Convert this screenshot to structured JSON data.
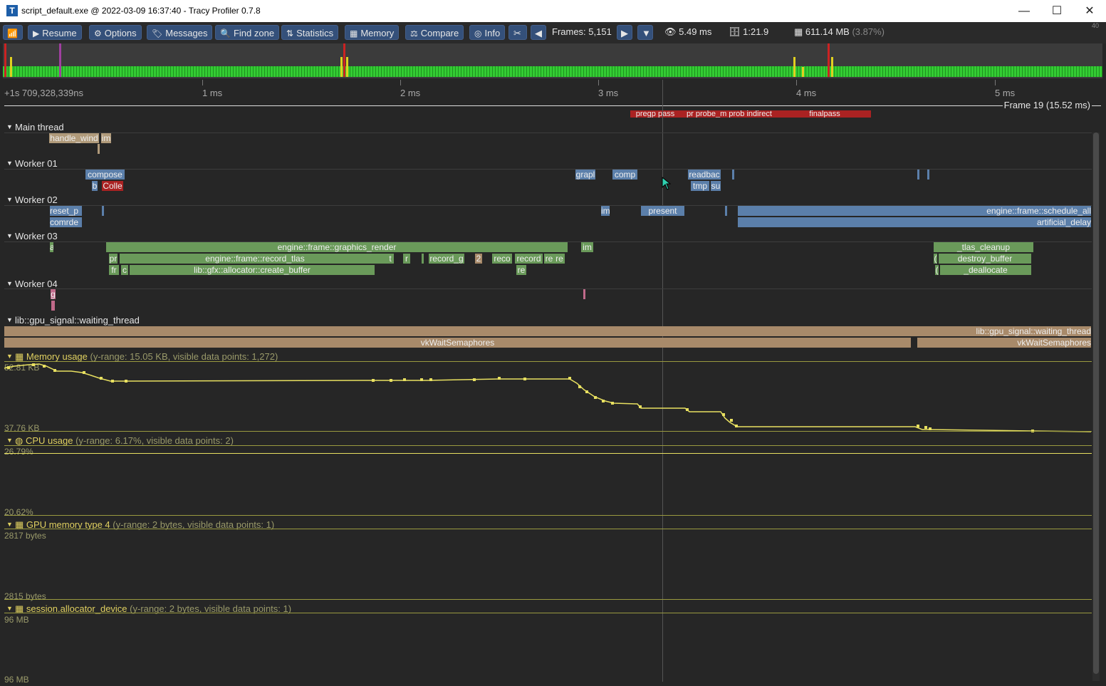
{
  "window": {
    "icon_letter": "T",
    "title": "script_default.exe @ 2022-03-09 16:37:40 - Tracy Profiler 0.7.8",
    "minimize": "—",
    "maximize": "☐",
    "close": "✕"
  },
  "toolbar": {
    "connection_icon": "wifi-icon",
    "resume": "Resume",
    "options": "Options",
    "messages": "Messages",
    "find_zone": "Find zone",
    "statistics": "Statistics",
    "memory": "Memory",
    "compare": "Compare",
    "info": "Info",
    "frames": "Frames: 5,151",
    "view_time": "5.49 ms",
    "total_time": "1:21.9",
    "memory_usage": "611.14 MB",
    "memory_pct": "(3.87%)",
    "corner": "40"
  },
  "timeline": {
    "start": "+1s 709,328,339ns",
    "ticks": [
      "1 ms",
      "2 ms",
      "3 ms",
      "4 ms",
      "5 ms"
    ],
    "frame_label": "Frame 19 (15.52 ms)",
    "top_zones": [
      "pregp",
      "pass",
      "pr",
      "probe_m",
      "prob",
      "indirect",
      "finalpass"
    ]
  },
  "threads": [
    {
      "name": "Main thread",
      "zones": [
        "handle_wind",
        "im"
      ]
    },
    {
      "name": "Worker 01",
      "zones": [
        "compose",
        "b",
        "Colle",
        "grapl",
        "comp",
        "readbac",
        "tmp",
        "su"
      ]
    },
    {
      "name": "Worker 02",
      "zones": [
        "reset_p",
        "comrde",
        "im",
        "present",
        "engine::frame::schedule_all",
        "artificial_delay"
      ]
    },
    {
      "name": "Worker 03",
      "zones": [
        "a",
        "engine::frame::graphics_render",
        "im",
        "pr",
        "engine::frame::record_tlas",
        "t",
        "r",
        "record_g",
        "2",
        "reco",
        "record",
        "re",
        "re",
        "fr",
        "c",
        "lib::gfx::allocator::create_buffer",
        "re",
        "_tlas_cleanup",
        "(",
        "destroy_buffer",
        "(",
        "_deallocate"
      ]
    },
    {
      "name": "Worker 04",
      "zones": [
        "g"
      ]
    },
    {
      "name": "lib::gpu_signal::waiting_thread",
      "zones": [
        "lib::gpu_signal::waiting_thread",
        "vkWaitSemaphores",
        "vkWaitSemaphores"
      ]
    }
  ],
  "plots": [
    {
      "name": "Memory usage",
      "range": "(y-range: 15.05 KB, visible data points: 1,272)",
      "max": "52.81 KB",
      "min": "37.76 KB"
    },
    {
      "name": "CPU usage",
      "range": "(y-range: 6.17%, visible data points: 2)",
      "max": "26.79%",
      "min": "20.62%"
    },
    {
      "name": "GPU memory type 4",
      "range": "(y-range: 2 bytes, visible data points: 1)",
      "max": "2817 bytes",
      "min": "2815 bytes"
    },
    {
      "name": "session.allocator_device",
      "range": "(y-range: 2 bytes, visible data points: 1)",
      "max": "96 MB",
      "min": "96 MB"
    }
  ]
}
